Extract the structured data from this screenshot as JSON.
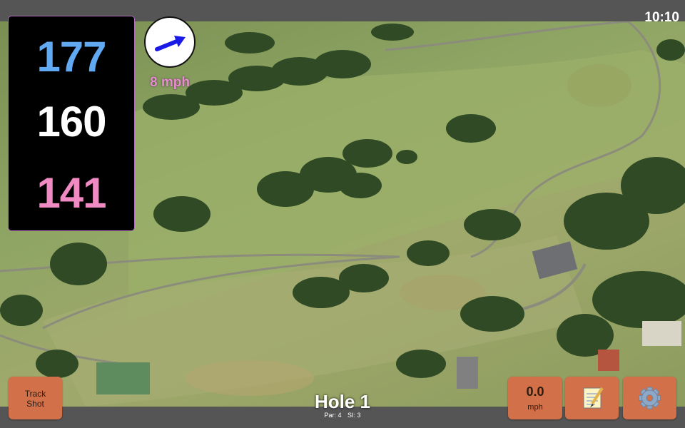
{
  "status_bar": {
    "time": "10:10"
  },
  "yardage": {
    "back": "177",
    "middle": "160",
    "front": "141"
  },
  "wind": {
    "speed": "8 mph",
    "direction_icon": "arrow-icon",
    "arrow_color": "#1a1ae6"
  },
  "buttons": {
    "track_shot_line1": "Track",
    "track_shot_line2": "Shot",
    "speed_value": "0.0",
    "speed_unit": "mph",
    "notes_icon": "notepad-icon",
    "settings_icon": "gear-icon"
  },
  "hole": {
    "title": "Hole 1",
    "par": "Par: 4",
    "si": "SI: 3"
  },
  "colors": {
    "button": "#d2704a",
    "back_yardage": "#62a9f3",
    "front_yardage": "#f08ac2",
    "wind_text": "#ea8ad0"
  }
}
